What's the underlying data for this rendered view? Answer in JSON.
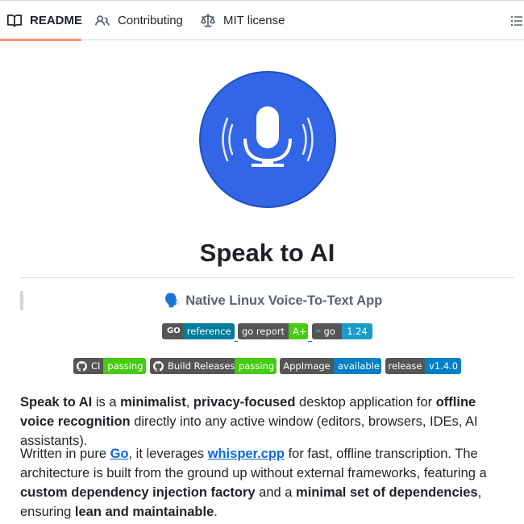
{
  "tabs": [
    {
      "label": "README",
      "icon": "book-icon",
      "active": true
    },
    {
      "label": "Contributing",
      "icon": "people-icon",
      "active": false
    },
    {
      "label": "MIT license",
      "icon": "law-scale-icon",
      "active": false
    }
  ],
  "colors": {
    "accent_underline": "#fd8c73",
    "logo_blue": "#3366e6",
    "link": "#0969da"
  },
  "title": "Speak to AI",
  "subtitle": {
    "emoji": "🗣️",
    "text": "Native Linux Voice-To-Text App"
  },
  "badges_row1": [
    {
      "left": "GO",
      "right": "reference",
      "color": "#007d9c",
      "left_icon": "go-logo-icon"
    },
    {
      "left": "go report",
      "right": "A+",
      "color": "#4c1"
    },
    {
      "left": "go",
      "right": "1.24",
      "color": "#1a9cc7",
      "left_icon": "gopher-icon"
    }
  ],
  "badges_row2": [
    {
      "left": "CI",
      "right": "passing",
      "color": "#4c1",
      "left_icon": "github-icon"
    },
    {
      "left": "Build Releases",
      "right": "passing",
      "color": "#4c1",
      "left_icon": "github-icon"
    },
    {
      "left": "AppImage",
      "right": "available",
      "color": "#007ec6"
    },
    {
      "left": "release",
      "right": "v1.4.0",
      "color": "#007ec6"
    }
  ],
  "para1": {
    "p1": "Speak to AI",
    "p2": " is a ",
    "p3": "minimalist",
    "p4": ", ",
    "p5": "privacy-focused",
    "p6": " desktop application for ",
    "p7": "offline voice recognition",
    "p8": " directly into any active window (editors, browsers, IDEs, AI assistants)."
  },
  "para2": {
    "p1": "Written in pure ",
    "link1": "Go",
    "p2": ", it leverages ",
    "link2": "whisper.cpp",
    "p3": " for fast, offline transcription. The architecture is built from the ground up without external frameworks, featuring a ",
    "p4": "custom dependency injection factory",
    "p5": " and a ",
    "p6": "minimal set of dependencies",
    "p7": ", ensuring ",
    "p8": "lean and maintainable",
    "p9": "."
  }
}
